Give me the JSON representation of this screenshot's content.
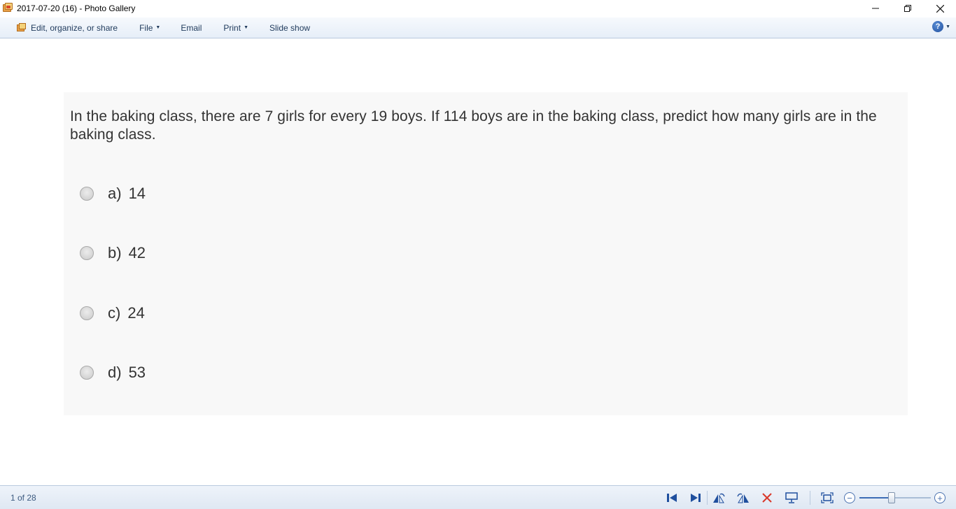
{
  "window": {
    "title": "2017-07-20 (16) - Photo Gallery",
    "controls": {
      "minimize": "─",
      "restore": "❐",
      "close": "✕"
    }
  },
  "menubar": {
    "edit": "Edit, organize, or share",
    "file": "File",
    "email": "Email",
    "print": "Print",
    "slideshow": "Slide show",
    "help": "?"
  },
  "quiz": {
    "question": "In the baking class, there are 7 girls for every 19 boys. If 114 boys are in the baking class, predict how many girls are in the baking class.",
    "options": [
      {
        "letter": "a)",
        "value": "14"
      },
      {
        "letter": "b)",
        "value": "42"
      },
      {
        "letter": "c)",
        "value": "24"
      },
      {
        "letter": "d)",
        "value": "53"
      }
    ]
  },
  "statusbar": {
    "counter": "1 of 28",
    "zoom_level": 0.45,
    "zoom_out": "−",
    "zoom_in": "+"
  },
  "colors": {
    "accent": "#1f4f9e",
    "delete": "#d9392b",
    "menu_text": "#1e395b"
  },
  "icons": [
    "previous-icon",
    "next-icon",
    "rotate-left-icon",
    "rotate-right-icon",
    "delete-icon",
    "slideshow-icon",
    "actual-size-icon",
    "zoom-out-icon",
    "zoom-in-icon"
  ]
}
